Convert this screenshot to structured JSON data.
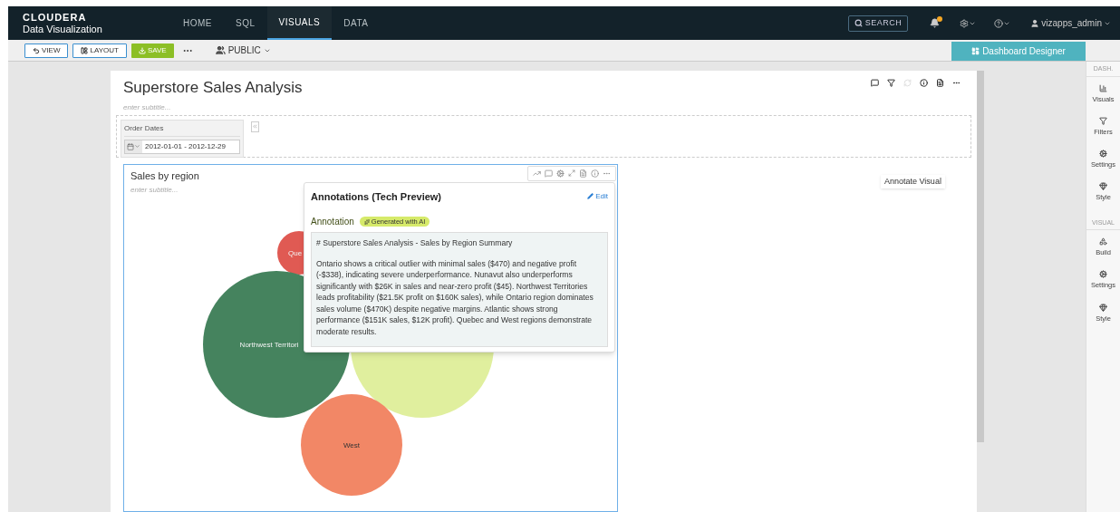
{
  "brand": {
    "name": "CLOUDERA",
    "product": "Data Visualization"
  },
  "nav": {
    "tabs": [
      {
        "label": "HOME",
        "selected": false
      },
      {
        "label": "SQL",
        "selected": false
      },
      {
        "label": "VISUALS",
        "selected": true
      },
      {
        "label": "DATA",
        "selected": false
      }
    ],
    "search": "SEARCH",
    "has_notification": true,
    "user": "vizapps_admin"
  },
  "toolbar": {
    "buttons": [
      {
        "label": "VIEW",
        "kind": "view"
      },
      {
        "label": "LAYOUT",
        "kind": "layout"
      },
      {
        "label": "SAVE",
        "kind": "save"
      }
    ],
    "visibility": "PUBLIC",
    "designer": "Dashboard Designer"
  },
  "sidebar": {
    "sections": [
      {
        "title": "DASH.",
        "items": [
          {
            "label": "Visuals",
            "kind": "visuals"
          },
          {
            "label": "Filters",
            "kind": "filters"
          },
          {
            "label": "Settings",
            "kind": "settings"
          },
          {
            "label": "Style",
            "kind": "style"
          }
        ]
      },
      {
        "title": "VISUAL",
        "items": [
          {
            "label": "Build",
            "kind": "build"
          },
          {
            "label": "Settings",
            "kind": "settings"
          },
          {
            "label": "Style",
            "kind": "style"
          }
        ]
      }
    ]
  },
  "dashboard": {
    "title": "Superstore Sales Analysis",
    "subtitle_placeholder": "enter subtitle...",
    "actions": [
      {
        "kind": "comment",
        "disabled": false
      },
      {
        "kind": "filter",
        "disabled": false
      },
      {
        "kind": "refresh",
        "disabled": true
      },
      {
        "kind": "info",
        "disabled": false
      },
      {
        "kind": "document",
        "disabled": false
      },
      {
        "kind": "more",
        "disabled": false
      }
    ],
    "filter": {
      "label": "Order Dates",
      "value": "2012-01-01 - 2012-12-29"
    },
    "tooltip": "Annotate Visual"
  },
  "visual": {
    "title": "Sales by region",
    "subtitle_placeholder": "enter subtitle...",
    "bubbles": [
      {
        "label": "Que",
        "color": "#e05a53"
      },
      {
        "label": "Northwest Territori",
        "color": "#45835e"
      },
      {
        "color": "#e0ef9e"
      },
      {
        "label": "West",
        "color": "#f28766"
      }
    ],
    "annotation": {
      "heading": "Annotations (Tech Preview)",
      "edit": "Edit",
      "label": "Annotation",
      "badge": "Generated with AI",
      "paragraphs": [
        "# Superstore Sales Analysis - Sales by Region Summary",
        "Ontario shows a critical outlier with minimal sales ($470) and negative profit (-$338), indicating severe underperformance. Nunavut also underperforms significantly with $26K in sales and near-zero profit ($45). Northwest Territories leads profitability ($21.5K profit on $160K sales), while Ontario region dominates sales volume ($470K) despite negative margins. Atlantic shows strong performance ($151K sales, $12K profit). Quebec and West regions demonstrate moderate results."
      ]
    }
  }
}
